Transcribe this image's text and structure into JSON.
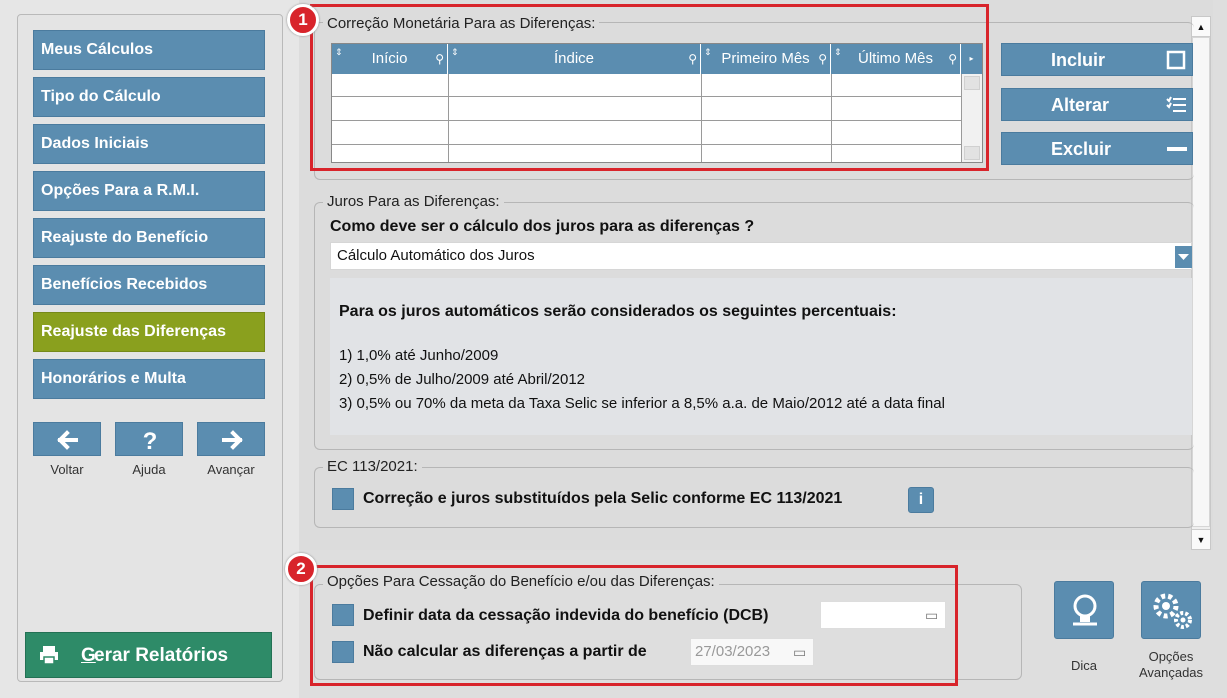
{
  "nav": {
    "items": [
      {
        "label": "Meus Cálculos"
      },
      {
        "label": "Tipo do Cálculo"
      },
      {
        "label": "Dados Iniciais"
      },
      {
        "label": "Opções Para a R.M.I."
      },
      {
        "label": "Reajuste do Benefício"
      },
      {
        "label": "Benefícios Recebidos"
      },
      {
        "label": "Reajuste das Diferenças"
      },
      {
        "label": "Honorários e Multa"
      }
    ],
    "active_index": 6,
    "voltar": "Voltar",
    "ajuda": "Ajuda",
    "avancar": "Avançar",
    "gerar_prefix": "G",
    "gerar_rest": "erar Relatórios"
  },
  "correcao": {
    "title": "Correção Monetária Para as Diferenças:",
    "columns": [
      "Início",
      "Índice",
      "Primeiro Mês",
      "Último Mês"
    ],
    "rows": []
  },
  "side_buttons": {
    "incluir": "Incluir",
    "alterar": "Alterar",
    "excluir": "Excluir"
  },
  "juros": {
    "title": "Juros Para as Diferenças:",
    "question": "Como deve ser o cálculo dos juros para as diferenças ?",
    "selected": "Cálculo Automático dos Juros",
    "info_heading": "Para os juros automáticos serão considerados os seguintes percentuais:",
    "info_lines": [
      "1) 1,0% até Junho/2009",
      "2) 0,5% de Julho/2009 até Abril/2012",
      "3) 0,5% ou 70% da meta da Taxa Selic se inferior a 8,5% a.a. de Maio/2012 até a data final"
    ]
  },
  "ec": {
    "title": "EC 113/2021:",
    "checkbox_label": "Correção e juros substituídos pela Selic conforme EC 113/2021",
    "checked": false,
    "info_icon": "i"
  },
  "cessacao": {
    "title": "Opções Para Cessação do Benefício e/ou das Diferenças:",
    "dcb_label": "Definir data da cessação indevida do benefício (DCB)",
    "dcb_value": "",
    "nao_calcular_label": "Não calcular as diferenças a partir de",
    "nao_calcular_value": "27/03/2023"
  },
  "badges": {
    "one": "1",
    "two": "2"
  },
  "tiles": {
    "dica": "Dica",
    "opcoes_1": "Opções",
    "opcoes_2": "Avançadas"
  },
  "colors": {
    "nav_blue": "#5b8db0",
    "nav_active": "#8aa01e",
    "gerar_green": "#2e8b68",
    "highlight_red": "#d8242b"
  }
}
